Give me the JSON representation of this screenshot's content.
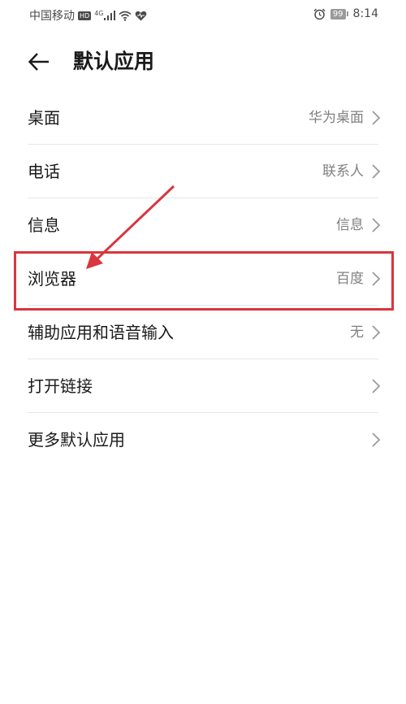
{
  "status_bar": {
    "carrier": "中国移动",
    "hd_label": "HD",
    "network_label": "4G",
    "battery_level": "99",
    "time": "8:14"
  },
  "header": {
    "title": "默认应用"
  },
  "rows": [
    {
      "label": "桌面",
      "value": "华为桌面"
    },
    {
      "label": "电话",
      "value": "联系人"
    },
    {
      "label": "信息",
      "value": "信息"
    },
    {
      "label": "浏览器",
      "value": "百度"
    },
    {
      "label": "辅助应用和语音输入",
      "value": "无"
    },
    {
      "label": "打开链接",
      "value": ""
    },
    {
      "label": "更多默认应用",
      "value": ""
    }
  ],
  "annotation": {
    "color": "#d9363e",
    "highlighted_row": "浏览器"
  },
  "colors": {
    "background": "#ffffff",
    "text_primary": "#1a1a1a",
    "text_secondary": "#808080",
    "divider": "#e6e6e6",
    "annotation": "#d9363e"
  },
  "icons": {
    "back": "arrow-left-icon",
    "chevron": "chevron-right-icon",
    "signal": "signal-bars-icon",
    "wifi": "wifi-icon",
    "heart": "heart-icon",
    "alarm": "alarm-clock-icon"
  }
}
